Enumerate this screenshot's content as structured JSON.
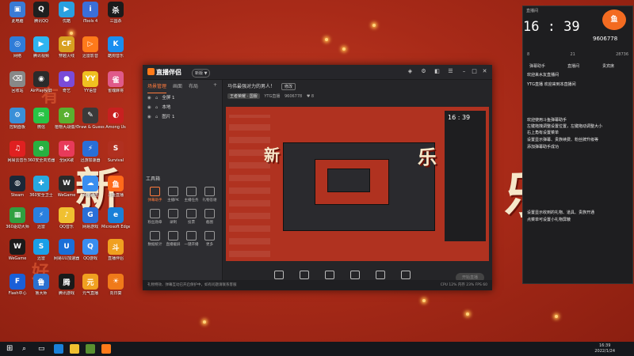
{
  "desktop_icons": [
    {
      "label": "此电脑",
      "color": "#3a7bd5",
      "glyph": "▣"
    },
    {
      "label": "腾讯QQ",
      "color": "#1f1f1f",
      "glyph": "Q"
    },
    {
      "label": "优酷",
      "color": "#2aa0e0",
      "glyph": "▶"
    },
    {
      "label": "iTools 4",
      "color": "#3b6fd8",
      "glyph": "i"
    },
    {
      "label": "三国杀",
      "color": "#1b1b1b",
      "glyph": "杀"
    },
    {
      "label": "网络",
      "color": "#2f7cd8",
      "glyph": "◎"
    },
    {
      "label": "腾讯视频",
      "color": "#2fb5f0",
      "glyph": "▶"
    },
    {
      "label": "穿越火线",
      "color": "#d8a020",
      "glyph": "CF"
    },
    {
      "label": "迅雷影音",
      "color": "#ff7a1a",
      "glyph": "▷"
    },
    {
      "label": "酷狗音乐",
      "color": "#1a8ef0",
      "glyph": "K"
    },
    {
      "label": "回收站",
      "color": "#888888",
      "glyph": "⌫"
    },
    {
      "label": "AirPlay投屏",
      "color": "#2b2b2b",
      "glyph": "◉"
    },
    {
      "label": "奇艺",
      "color": "#7a4bd8",
      "glyph": "●"
    },
    {
      "label": "YY语音",
      "color": "#f0c020",
      "glyph": "YY"
    },
    {
      "label": "雀魂麻将",
      "color": "#e05a8a",
      "glyph": "雀"
    },
    {
      "label": "控制面板",
      "color": "#3a8fd8",
      "glyph": "⚙"
    },
    {
      "label": "微信",
      "color": "#28c445",
      "glyph": "✉"
    },
    {
      "label": "植物大战僵尸",
      "color": "#5ab030",
      "glyph": "✿"
    },
    {
      "label": "Draw & Guess",
      "color": "#3a3a3a",
      "glyph": "✎"
    },
    {
      "label": "Among Us",
      "color": "#c82020",
      "glyph": "◐"
    },
    {
      "label": "网易云音乐",
      "color": "#e02020",
      "glyph": "♫"
    },
    {
      "label": "360安全浏览器",
      "color": "#28b040",
      "glyph": "e"
    },
    {
      "label": "全民K歌",
      "color": "#e83a5a",
      "glyph": "K"
    },
    {
      "label": "迅游加速器",
      "color": "#2a6fd8",
      "glyph": "⚡"
    },
    {
      "label": "Survival",
      "color": "#b03020",
      "glyph": "S"
    },
    {
      "label": "Steam",
      "color": "#1b2838",
      "glyph": "◍"
    },
    {
      "label": "360安全卫士",
      "color": "#28a8e0",
      "glyph": "✚"
    },
    {
      "label": "WeGame",
      "color": "#2a2a2a",
      "glyph": "W"
    },
    {
      "label": "百度网盘",
      "color": "#3a8ef0",
      "glyph": "☁"
    },
    {
      "label": "斗鱼直播",
      "color": "#ff6a1a",
      "glyph": "鱼"
    },
    {
      "label": "360驱动大师",
      "color": "#30a040",
      "glyph": "▦"
    },
    {
      "label": "迅雷",
      "color": "#2a80e0",
      "glyph": "⚡"
    },
    {
      "label": "QQ音乐",
      "color": "#f0c030",
      "glyph": "♪"
    },
    {
      "label": "网易游戏",
      "color": "#2a6fd8",
      "glyph": "G"
    },
    {
      "label": "Microsoft Edge",
      "color": "#1a80d8",
      "glyph": "e"
    },
    {
      "label": "WeGame",
      "color": "#1a1a1a",
      "glyph": "W"
    },
    {
      "label": "迅雷",
      "color": "#1a9fe8",
      "glyph": "S"
    },
    {
      "label": "网易UU加速器",
      "color": "#1a6fd8",
      "glyph": "U"
    },
    {
      "label": "QQ游戏",
      "color": "#3a8ef0",
      "glyph": "Q"
    },
    {
      "label": "直播伴侣",
      "color": "#f0a020",
      "glyph": "斗"
    },
    {
      "label": "Flash中心",
      "color": "#1a5fd8",
      "glyph": "F"
    },
    {
      "label": "鲁大师",
      "color": "#2a70d0",
      "glyph": "鲁"
    },
    {
      "label": "腾讯游戏",
      "color": "#1a1a1a",
      "glyph": "腾"
    },
    {
      "label": "元气直播",
      "color": "#f0a020",
      "glyph": "元"
    },
    {
      "label": "向日葵",
      "color": "#f07a1a",
      "glyph": "☀"
    }
  ],
  "app": {
    "name": "直播伴侣",
    "version": "新版 ▼",
    "left_tabs": [
      "场景管理",
      "画面",
      "布局"
    ],
    "scenes": [
      "全屏 1",
      "本地",
      "图片 1"
    ],
    "tools_title": "工具箱",
    "tools": [
      "弹幕助手",
      "主播PK",
      "主播任务",
      "礼物答谢",
      "粉丝勋章",
      "录制",
      "投票",
      "截图",
      "数据统计",
      "直播截屏",
      "一键开播",
      "更多"
    ],
    "stream_title": "马伟最强对力的男人！",
    "edit_btn": "修改",
    "category": "王者荣耀 · 国服",
    "room_label": "YTG直播",
    "room_id": "9606778",
    "fans": "8",
    "controls": [
      "直播屏幕",
      "摄像头",
      "手机投屏",
      "多媒体",
      "麦克风",
      "扬声器"
    ],
    "golive": "开始直播",
    "status": "礼物特效、弹幕互动已开启保护中，如有问题请联系客服",
    "status_right": "CPU 12%   内存 23%   FPS 60"
  },
  "chat": {
    "header": "直播间",
    "time": "16 : 39",
    "viewers": "9606778",
    "stats": [
      "8",
      "21",
      "28736"
    ],
    "tabs": [
      "弹幕助手",
      "直播间",
      "贵宾席"
    ],
    "messages": [
      "欢迎来水友直播间",
      "YTG直播  欢迎来到本直播间",
      "欢迎使用斗鱼弹幕助手",
      "左键拖拽调整设置位置，左键拖动调整大小",
      "右上角有设置菜单",
      "设置显示弹幕、贵族续费、粉丝牌升级等",
      "添加弹幕助手成功",
      "设置显示收到的礼物、道具、贵族开通",
      "点菜单可设置小礼物屏蔽"
    ]
  },
  "taskbar": {
    "time": "16:39",
    "date": "2022/1/24"
  },
  "big_chars": [
    "新",
    "乐",
    "有",
    "好"
  ]
}
